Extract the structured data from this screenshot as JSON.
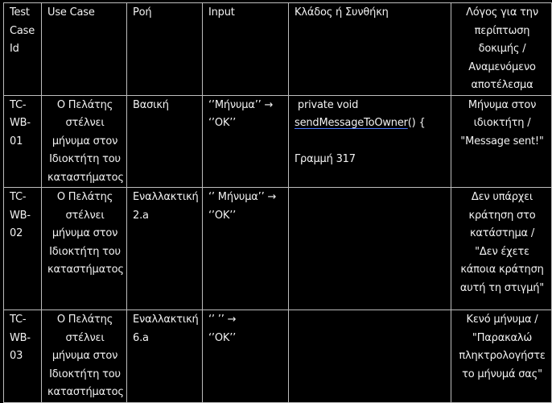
{
  "header": {
    "id_lines": [
      "Test",
      "Case",
      "Id"
    ],
    "use_case": "Use Case",
    "flow": "Ροή",
    "input": "Input",
    "branch": "Κλάδος ή Συνθήκη",
    "reason_lines": [
      "Λόγος για την",
      "περίπτωση",
      "δοκιμής /",
      "Αναμενόμενο",
      "αποτέλεσμα"
    ]
  },
  "rows": [
    {
      "id_lines": [
        "TC-",
        "WB-",
        "01"
      ],
      "use_case_lines": [
        "Ο Πελάτης",
        "στέλνει",
        "μήνυμα στον",
        "Ιδιοκτήτη του",
        "καταστήματος"
      ],
      "flow_lines": [
        "Βασική"
      ],
      "input_lines": [
        "‘’Μήνυμα’’ →",
        "‘’ΟΚ’’"
      ],
      "branch": {
        "code_line": " private void",
        "method_name": "sendMessageToOwner",
        "method_suffix": "() {",
        "line_ref": "Γραμμή 317"
      },
      "reason_lines": [
        "Μήνυμα στον",
        "ιδιοκτήτη /",
        "\"Message sent!\""
      ]
    },
    {
      "id_lines": [
        "TC-",
        "WB-",
        "02"
      ],
      "use_case_lines": [
        "Ο Πελάτης",
        "στέλνει",
        "μήνυμα στον",
        "Ιδιοκτήτη του",
        "καταστήματος"
      ],
      "flow_lines": [
        "Εναλλακτική",
        "2.a"
      ],
      "input_lines": [
        "‘’ Μήνυμα’’ →",
        "‘’ΟΚ’’"
      ],
      "reason_lines": [
        "Δεν υπάρχει",
        "κράτηση στο",
        "κατάστημα /",
        "\"Δεν έχετε",
        "κάποια κράτηση",
        "αυτή τη στιγμή\""
      ]
    },
    {
      "id_lines": [
        "TC-",
        "WB-",
        "03"
      ],
      "use_case_lines": [
        "Ο Πελάτης",
        "στέλνει",
        "μήνυμα στον",
        "Ιδιοκτήτη του",
        "καταστήματος"
      ],
      "flow_lines": [
        "Εναλλακτική",
        "6.a"
      ],
      "input_lines": [
        "‘’ ’’ →",
        "‘’ΟΚ’’"
      ],
      "reason_lines": [
        "Κενό μήνυμα /",
        "\"Παρακαλώ",
        "πληκτρολογήστε",
        "το μήνυμά σας\""
      ]
    }
  ]
}
